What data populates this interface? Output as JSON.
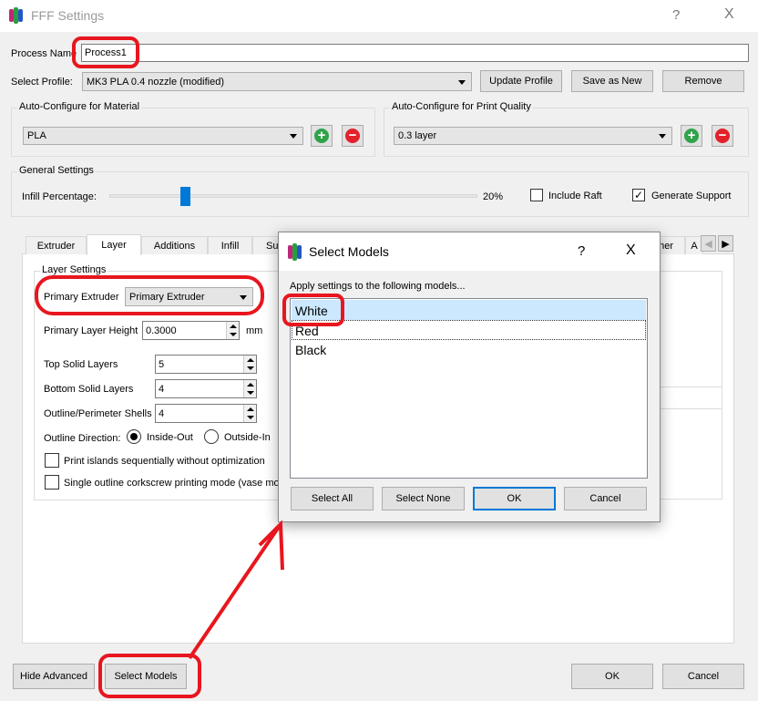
{
  "window": {
    "title": "FFF Settings",
    "help": "?",
    "close": "X"
  },
  "process": {
    "label": "Process Name",
    "value": "Process1"
  },
  "profile": {
    "label": "Select Profile:",
    "value": "MK3 PLA 0.4 nozzle (modified)",
    "update": "Update Profile",
    "save_new": "Save as New",
    "remove": "Remove"
  },
  "material": {
    "title": "Auto-Configure for Material",
    "value": "PLA"
  },
  "quality": {
    "title": "Auto-Configure for Print Quality",
    "value": "0.3 layer"
  },
  "general": {
    "title": "General Settings",
    "infill_label": "Infill Percentage:",
    "infill_value": "20%",
    "infill_percent": 20,
    "raft": "Include Raft",
    "raft_checked": false,
    "support": "Generate Support",
    "support_checked": true
  },
  "tabs": [
    {
      "label": "Extruder"
    },
    {
      "label": "Layer",
      "active": true
    },
    {
      "label": "Additions"
    },
    {
      "label": "Infill"
    },
    {
      "label": "Su"
    },
    {
      "label": "her"
    },
    {
      "label": "A"
    }
  ],
  "layer": {
    "title": "Layer Settings",
    "primary_extruder_label": "Primary Extruder",
    "primary_extruder_value": "Primary Extruder",
    "layer_height_label": "Primary Layer Height",
    "layer_height_value": "0.3000",
    "layer_height_unit": "mm",
    "top_label": "Top Solid Layers",
    "top_value": "5",
    "bottom_label": "Bottom Solid Layers",
    "bottom_value": "4",
    "shells_label": "Outline/Perimeter Shells",
    "shells_value": "4",
    "direction_label": "Outline Direction:",
    "inside_out": "Inside-Out",
    "outside_in": "Outside-In",
    "islands": "Print islands sequentially without optimization",
    "vase": "Single outline corkscrew printing mode (vase mod"
  },
  "footer": {
    "hide_advanced": "Hide Advanced",
    "select_models": "Select Models",
    "ok": "OK",
    "cancel": "Cancel"
  },
  "dialog": {
    "title": "Select Models",
    "help": "?",
    "close": "X",
    "prompt": "Apply settings to the following models...",
    "models": [
      {
        "name": "White",
        "selected": true
      },
      {
        "name": "Red"
      },
      {
        "name": "Black"
      }
    ],
    "select_all": "Select All",
    "select_none": "Select None",
    "ok": "OK",
    "cancel": "Cancel"
  },
  "colors": {
    "annotation": "#e8161e",
    "selection": "#cce8ff",
    "accent": "#0078d7"
  }
}
